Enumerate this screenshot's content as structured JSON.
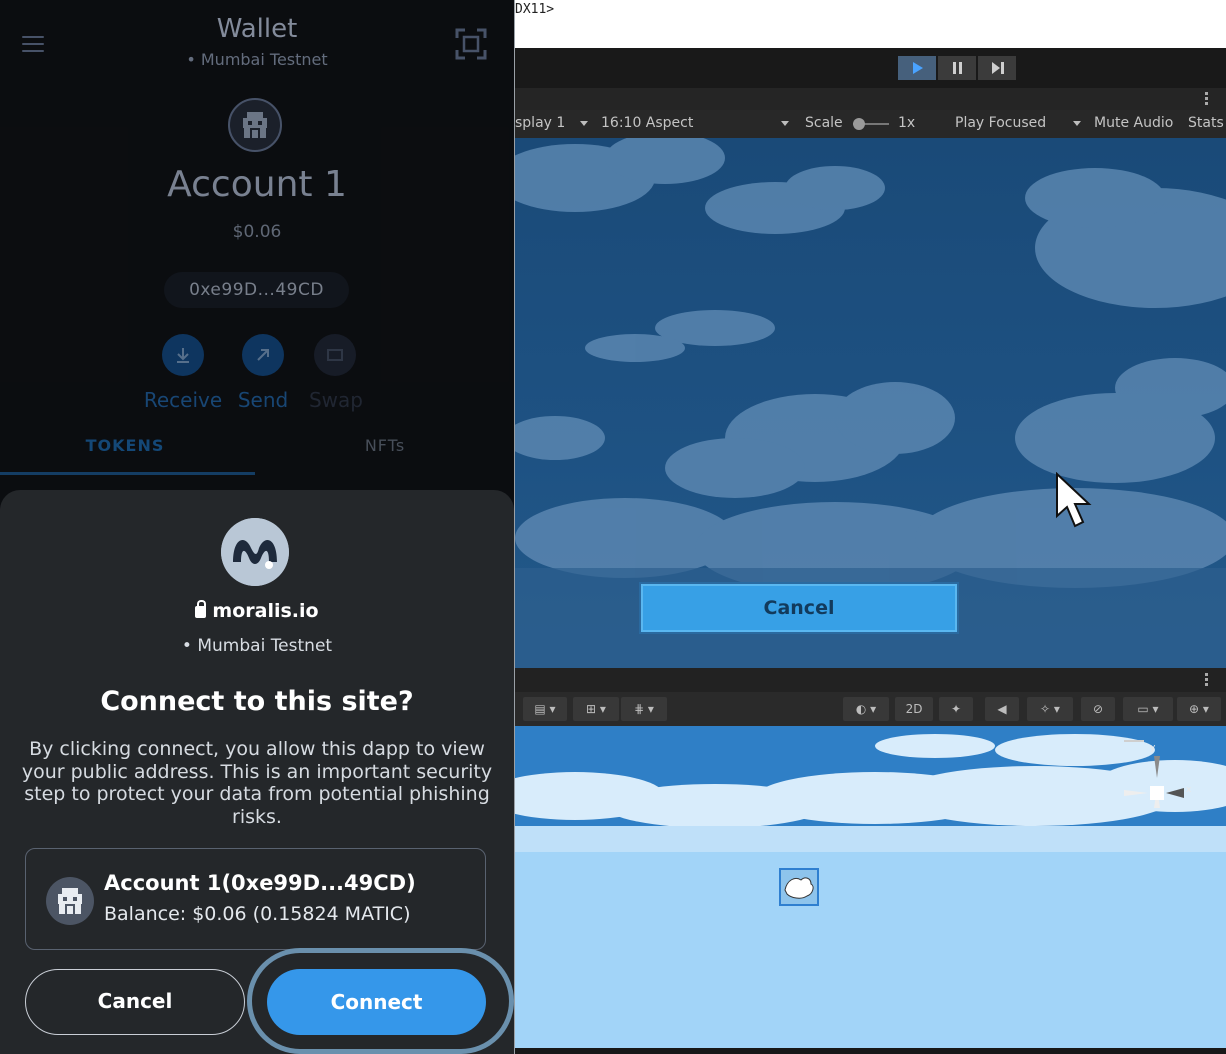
{
  "wallet": {
    "title": "Wallet",
    "network": "• Mumbai Testnet",
    "account_name": "Account 1",
    "balance_usd": "$0.06",
    "address_short": "0xe99D...49CD",
    "actions": [
      {
        "label": "Receive",
        "icon": "download-icon"
      },
      {
        "label": "Send",
        "icon": "arrow-up-right-icon"
      },
      {
        "label": "Swap",
        "icon": "swap-icon"
      }
    ],
    "tabs": [
      "TOKENS",
      "NFTs"
    ],
    "active_tab": "TOKENS"
  },
  "connect_sheet": {
    "site": "moralis.io",
    "network": "• Mumbai Testnet",
    "title": "Connect to this site?",
    "description": "By clicking connect, you allow this dapp to view your public address. This is an important security step to protect your data from potential phishing risks.",
    "account_label": "Account 1(0xe99D...49CD)",
    "account_balance": "Balance: $0.06 (0.15824 MATIC)",
    "cancel_label": "Cancel",
    "connect_label": "Connect"
  },
  "editor": {
    "title_fragment": "DX11>",
    "game_toolbar": {
      "display": "splay 1",
      "aspect": "16:10 Aspect",
      "scale_label": "Scale",
      "scale_value": "1x",
      "play_mode": "Play Focused",
      "mute": "Mute Audio",
      "stats": "Stats"
    },
    "game_button": "Cancel",
    "scene_2d_label": "2D",
    "gizmo_axes": {
      "y": "y",
      "x": "x"
    }
  },
  "colors": {
    "metamask_blue": "#3597ea",
    "sheet_bg": "#24272a",
    "game_sky": "#1d4f7d",
    "scene_sky": "#9dd0f6"
  }
}
